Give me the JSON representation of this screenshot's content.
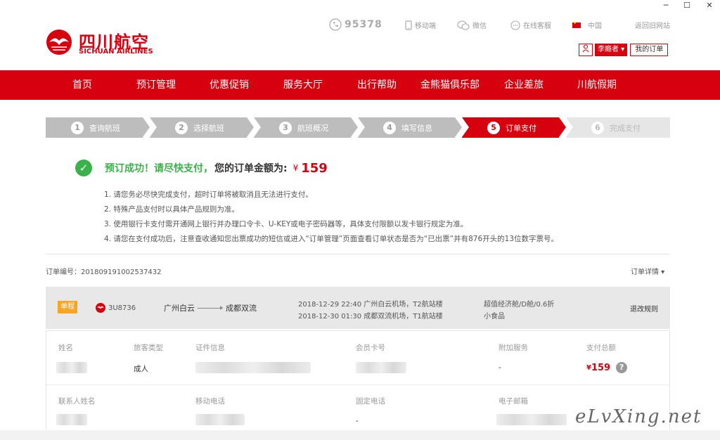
{
  "window": {
    "minimize": "─",
    "maximize": "☐",
    "close": "✕"
  },
  "header": {
    "logo_cn": "四川航空",
    "logo_en": "SICHUAN AIRLINES",
    "phone": "95378",
    "mobile": "移动端",
    "wechat": "微信",
    "online_service": "在线客服",
    "region": "中国",
    "old_site": "返回旧网站",
    "user_name": "李瘾者 ▾",
    "my_orders": "我的订单"
  },
  "nav": [
    "首页",
    "预订管理",
    "优惠促销",
    "服务大厅",
    "出行帮助",
    "金熊猫俱乐部",
    "企业差旅",
    "川航假期"
  ],
  "steps": [
    {
      "num": "1",
      "label": "查询航班"
    },
    {
      "num": "2",
      "label": "选择航班"
    },
    {
      "num": "3",
      "label": "航班概况"
    },
    {
      "num": "4",
      "label": "填写信息"
    },
    {
      "num": "5",
      "label": "订单支付"
    },
    {
      "num": "6",
      "label": "完成支付"
    }
  ],
  "success": {
    "green": "预订成功！请尽快支付，",
    "black": "您的订单金额为:",
    "currency": "¥",
    "amount": "159"
  },
  "notes": [
    "1. 请您务必尽快完成支付，超时订单将被取消且无法进行支付。",
    "2. 特殊产品支付时以具体产品规则为准。",
    "3. 使用银行卡支付需开通网上银行并办理口令卡、U-KEY或电子密码器等，具体支付限额以发卡银行规定为准。",
    "4. 请您在支付成功后，注意查收通知您出票成功的短信或进入“订单管理”页面查看订单状态是否为“已出票”并有876开头的13位数字票号。"
  ],
  "order": {
    "number_label": "订单编号：201809191002537432",
    "detail_label": "订单详情 ▾"
  },
  "flight": {
    "badge": "单程",
    "number": "3U8736",
    "from": "广州白云",
    "to": "成都双流",
    "dep": "2018-12-29  22:40  广州白云机场，T2航站楼",
    "arr": "2018-12-30  01:30  成都双流机场，T1航站楼",
    "cabin": "超值经济舱/D舱/0.6折",
    "meal": "小食品",
    "refund_rule": "退改规则"
  },
  "passenger": {
    "headers": [
      "姓名",
      "旅客类型",
      "证件信息",
      "会员卡号",
      "附加服务",
      "支付总额"
    ],
    "type": "成人",
    "extra": "-",
    "currency": "¥",
    "total": "159",
    "help": "?"
  },
  "contact": {
    "headers": [
      "联系人姓名",
      "移动电话",
      "固定电话",
      "电子邮箱"
    ],
    "landline": "-"
  },
  "watermark": "eLvXing.net",
  "colors": {
    "brand_red": "#d7000f",
    "success_green": "#3bb14a",
    "badge_orange": "#f5a623"
  }
}
